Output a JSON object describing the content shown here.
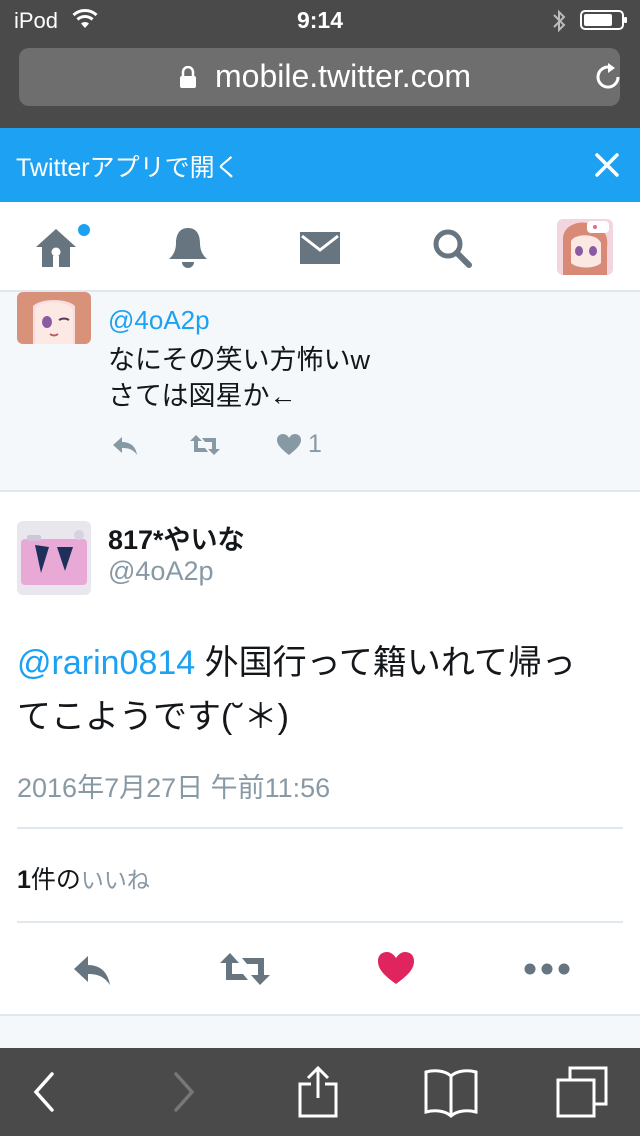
{
  "status_bar": {
    "carrier": "iPod",
    "time": "9:14"
  },
  "browser": {
    "url": "mobile.twitter.com"
  },
  "app_banner": {
    "text": "Twitterアプリで開く"
  },
  "twitter_nav": {
    "items": [
      "home-icon",
      "notifications-icon",
      "messages-icon",
      "search-icon",
      "profile-avatar"
    ],
    "accent_color": "#1da1f2"
  },
  "prev_tweet": {
    "handle": "@4oA2p",
    "text_line1": "なにその笑い方怖いw",
    "text_line2": "さては図星か←",
    "like_count": "1"
  },
  "main_tweet": {
    "display_name": "817*やいな",
    "handle": "@4oA2p",
    "mention": "@rarin0814",
    "text_line1": " 外国行って籍いれて帰っ",
    "text_line2": "てこようです(˘＊)",
    "date": "2016年7月27日 午前11:56",
    "likes_count": "1",
    "likes_unit": "件の",
    "likes_label": "いいね",
    "liked": true,
    "like_color": "#e0245e"
  },
  "colors": {
    "link": "#1da1f2",
    "muted": "#8899a6",
    "safari_chrome": "#4a4a4a"
  }
}
